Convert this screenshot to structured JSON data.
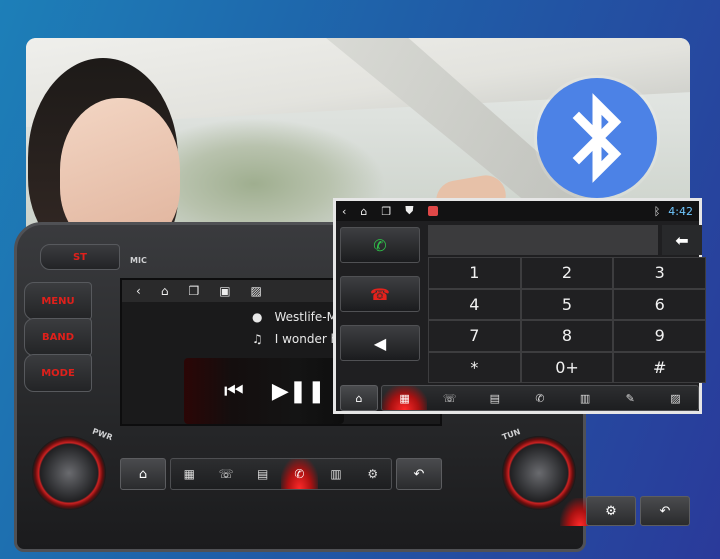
{
  "head_unit": {
    "mic_label": "MIC",
    "st_label": "ST",
    "side_buttons": [
      "MENU",
      "BAND",
      "MODE"
    ],
    "left_knob_label": "PWR",
    "right_knob_label": "TUN",
    "track": {
      "artist": "Westlife-M",
      "title": "I wonder h"
    },
    "player": {
      "prev_icon": "⏮",
      "play_icon": "▶❚❚"
    },
    "dock": [
      "⌂",
      "▦",
      "☏",
      "▤",
      "✆",
      "▥",
      "⚙",
      "↶"
    ]
  },
  "phone_screen": {
    "status": {
      "time": "4:42",
      "bluetooth_icon": "ᛒ"
    },
    "call_buttons": [
      {
        "name": "answer",
        "icon": "✆",
        "color": "#2fc24a"
      },
      {
        "name": "hangup",
        "icon": "☎",
        "color": "#e3221c"
      },
      {
        "name": "mute",
        "icon": "◀"
      }
    ],
    "backspace": "⬅",
    "keys": [
      "1",
      "2",
      "3",
      "4",
      "5",
      "6",
      "7",
      "8",
      "9",
      "*",
      "0+",
      "#"
    ],
    "dock": [
      "⌂",
      "▦",
      "☏",
      "▤",
      "✆",
      "▥",
      "✎",
      "▨"
    ]
  },
  "colors": {
    "accent_red": "#e0201b",
    "bluetooth_blue": "#4c82e6",
    "time_blue": "#6fc7ff"
  }
}
